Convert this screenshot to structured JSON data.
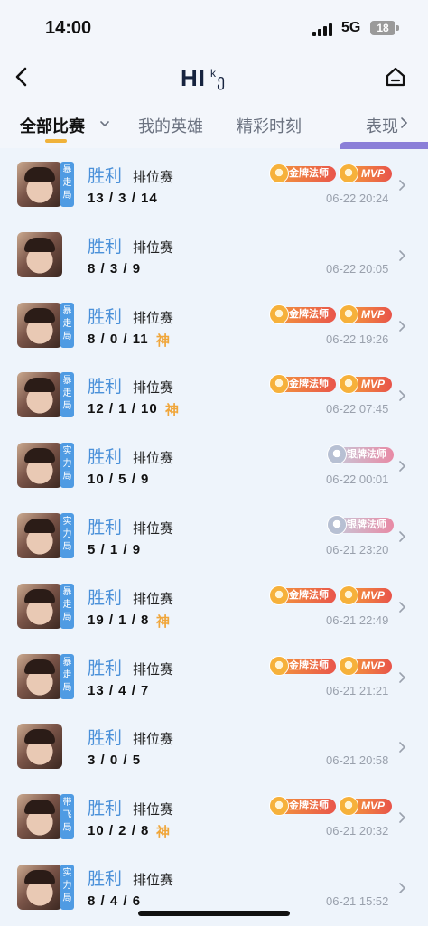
{
  "status_bar": {
    "time": "14:00",
    "network": "5G",
    "battery": "18"
  },
  "header": {
    "logo_main": "HI",
    "logo_sup": "k",
    "logo_extra": "ე"
  },
  "tabs": [
    {
      "label": "全部比赛"
    },
    {
      "label": "我的英雄"
    },
    {
      "label": "精彩时刻"
    },
    {
      "label": "表现"
    }
  ],
  "colors": {
    "accent": "#4a90d9",
    "highlight": "#f0a63a",
    "tab_underline": "#f0b23a"
  },
  "matches": [
    {
      "mode": "暴走局",
      "result": "胜利",
      "type": "排位赛",
      "kda": "13 / 3 / 14",
      "god": "",
      "badge1": "金牌法师",
      "badge1_kind": "gold",
      "mvp": "MVP",
      "time": "06-22 20:24"
    },
    {
      "mode": "",
      "result": "胜利",
      "type": "排位赛",
      "kda": "8 / 3 / 9",
      "god": "",
      "badge1": "",
      "badge1_kind": "",
      "mvp": "",
      "time": "06-22 20:05"
    },
    {
      "mode": "暴走局",
      "result": "胜利",
      "type": "排位赛",
      "kda": "8 / 0 / 11",
      "god": "神",
      "badge1": "金牌法师",
      "badge1_kind": "gold",
      "mvp": "MVP",
      "time": "06-22 19:26"
    },
    {
      "mode": "暴走局",
      "result": "胜利",
      "type": "排位赛",
      "kda": "12 / 1 / 10",
      "god": "神",
      "badge1": "金牌法师",
      "badge1_kind": "gold",
      "mvp": "MVP",
      "time": "06-22 07:45"
    },
    {
      "mode": "实力局",
      "result": "胜利",
      "type": "排位赛",
      "kda": "10 / 5 / 9",
      "god": "",
      "badge1": "银牌法师",
      "badge1_kind": "silver",
      "mvp": "",
      "time": "06-22 00:01"
    },
    {
      "mode": "实力局",
      "result": "胜利",
      "type": "排位赛",
      "kda": "5 / 1 / 9",
      "god": "",
      "badge1": "银牌法师",
      "badge1_kind": "silver",
      "mvp": "",
      "time": "06-21 23:20"
    },
    {
      "mode": "暴走局",
      "result": "胜利",
      "type": "排位赛",
      "kda": "19 / 1 / 8",
      "god": "神",
      "badge1": "金牌法师",
      "badge1_kind": "gold",
      "mvp": "MVP",
      "time": "06-21 22:49"
    },
    {
      "mode": "暴走局",
      "result": "胜利",
      "type": "排位赛",
      "kda": "13 / 4 / 7",
      "god": "",
      "badge1": "金牌法师",
      "badge1_kind": "gold",
      "mvp": "MVP",
      "time": "06-21 21:21"
    },
    {
      "mode": "",
      "result": "胜利",
      "type": "排位赛",
      "kda": "3 / 0 / 5",
      "god": "",
      "badge1": "",
      "badge1_kind": "",
      "mvp": "",
      "time": "06-21 20:58"
    },
    {
      "mode": "带飞局",
      "result": "胜利",
      "type": "排位赛",
      "kda": "10 / 2 / 8",
      "god": "神",
      "badge1": "金牌法师",
      "badge1_kind": "gold",
      "mvp": "MVP",
      "time": "06-21 20:32"
    },
    {
      "mode": "实力局",
      "result": "胜利",
      "type": "排位赛",
      "kda": "8 / 4 / 6",
      "god": "",
      "badge1": "",
      "badge1_kind": "",
      "mvp": "",
      "time": "06-21 15:52"
    }
  ]
}
